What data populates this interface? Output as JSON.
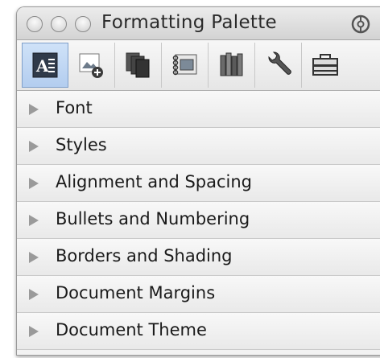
{
  "window": {
    "title": "Formatting Palette"
  },
  "toolbar": {
    "tools": [
      {
        "icon": "text-formatting-icon",
        "active": true
      },
      {
        "icon": "add-picture-icon",
        "active": false
      },
      {
        "icon": "copies-icon",
        "active": false
      },
      {
        "icon": "scrapbook-icon",
        "active": false
      },
      {
        "icon": "reference-books-icon",
        "active": false
      },
      {
        "icon": "wrench-icon",
        "active": false
      },
      {
        "icon": "toolbox-icon",
        "active": false
      }
    ]
  },
  "sections": [
    {
      "label": "Font"
    },
    {
      "label": "Styles"
    },
    {
      "label": "Alignment and Spacing"
    },
    {
      "label": "Bullets and Numbering"
    },
    {
      "label": "Borders and Shading"
    },
    {
      "label": "Document Margins"
    },
    {
      "label": "Document Theme"
    }
  ]
}
